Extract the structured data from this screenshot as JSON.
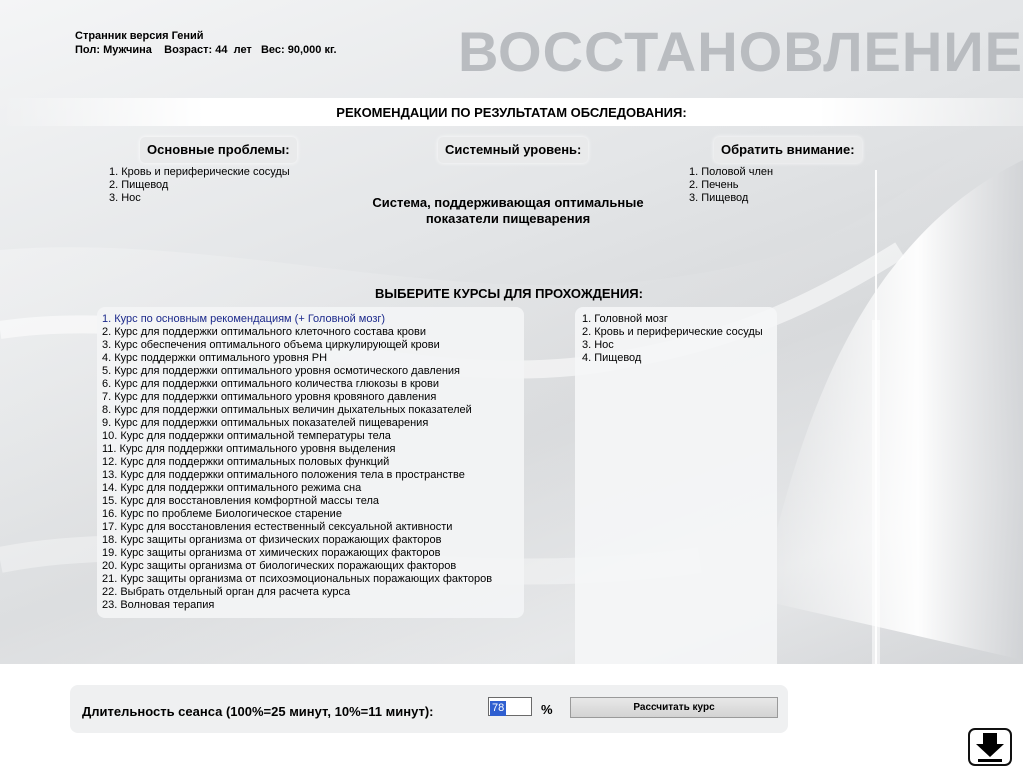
{
  "header": {
    "app_title": "Странник версия Гений",
    "gender_label": "Пол:",
    "gender_value": "Мужчина",
    "age_label": "Возраст:",
    "age_value": "44",
    "age_unit": "лет",
    "weight_label": "Вес:",
    "weight_value": "90,000",
    "weight_unit": "кг.",
    "big_heading": "ВОССТАНОВЛЕНИЕ"
  },
  "recommendations": {
    "heading": "РЕКОМЕНДАЦИИ ПО РЕЗУЛЬТАТАМ ОБСЛЕДОВАНИЯ:",
    "main_problems": {
      "title": "Основные проблемы:",
      "items": [
        "1. Кровь и периферические сосуды",
        "2. Пищевод",
        "3. Нос"
      ]
    },
    "system_level": {
      "title": "Системный уровень:",
      "text_line1": "Система, поддерживающая оптимальные",
      "text_line2": "показатели пищеварения"
    },
    "attention": {
      "title": "Обратить внимание:",
      "items": [
        "1. Половой член",
        "2. Печень",
        "3. Пищевод"
      ]
    }
  },
  "courses": {
    "heading": "ВЫБЕРИТЕ КУРСЫ ДЛЯ ПРОХОЖДЕНИЯ:",
    "selected_index": 0,
    "items": [
      "1. Курс по основным рекомендациям (+ Головной мозг)",
      "2. Курс для поддержки оптимального клеточного состава крови",
      "3. Курс  обеспечения оптимального объема циркулирующей крови",
      "4. Курс поддержки оптимального уровня PH",
      "5. Курс для поддержки оптимального уровня осмотического давления",
      "6. Курс для поддержки оптимального количества глюкозы в крови",
      "7. Курс для поддержки оптимального уровня кровяного давления",
      "8. Курс для поддержки оптимальных величин дыхательных показателей",
      "9. Курс для поддержки оптимальных показателей пищеварения",
      "10. Курс для поддержки оптимальной температуры тела",
      "11. Курс для поддержки оптимального уровня выделения",
      "12. Курс для поддержки оптимальных половых функций",
      "13. Курс для поддержки оптимального положения тела в пространстве",
      "14. Курс для поддержки оптимального режима сна",
      "15. Курс для восстановления комфортной массы тела",
      "16. Курс по проблеме Биологическое старение",
      "17. Курс для восстановления естественный сексуальной активности",
      "18. Курс защиты организма от физических поражающих факторов",
      "19. Курс защиты организма от химических поражающих факторов",
      "20. Курс защиты организма от биологических поражающих факторов",
      "21. Курс защиты организма от психоэмоциональных поражающих факторов",
      "22. Выбрать отдельный орган для расчета курса",
      "23. Волновая терапия"
    ],
    "selected_items": [
      "1. Головной мозг",
      "2. Кровь и периферические сосуды",
      "3. Нос",
      "4. Пищевод"
    ]
  },
  "session": {
    "duration_label": "Длительность сеанса (100%=25 минут, 10%=11 минут):",
    "duration_value": "78",
    "percent_sign": "%",
    "calc_button": "Рассчитать курс"
  },
  "icons": {
    "nav_button": "download-arrow-icon"
  },
  "colors": {
    "heading_gray": "#b9bcc0",
    "selection_blue": "#2f5fd0",
    "selected_item_text": "#1c2a8c"
  }
}
